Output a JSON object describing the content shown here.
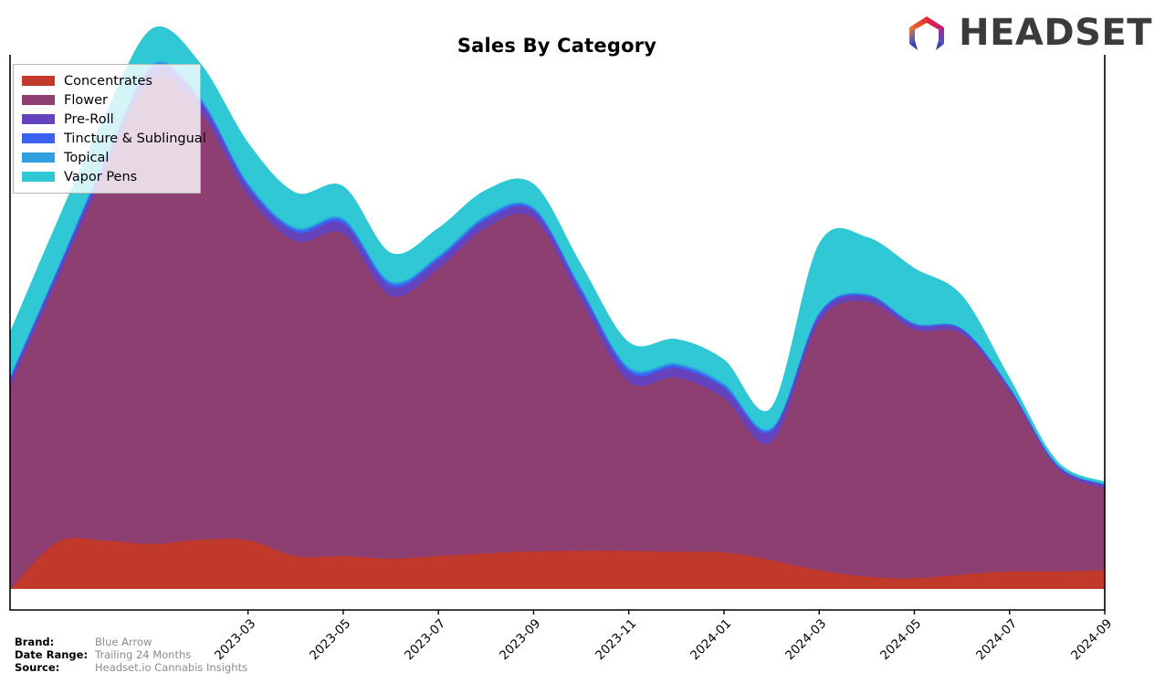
{
  "header": {
    "title": "Sales By Category",
    "logo_text": "HEADSET",
    "logo_icon": "headset-hexagon-logo"
  },
  "legend": {
    "position": "upper-left",
    "items": [
      {
        "label": "Concentrates",
        "color": "#c0392b"
      },
      {
        "label": "Flower",
        "color": "#8e3f72"
      },
      {
        "label": "Pre-Roll",
        "color": "#6543bd"
      },
      {
        "label": "Tincture & Sublingual",
        "color": "#3b63f0"
      },
      {
        "label": "Topical",
        "color": "#2f9fe0"
      },
      {
        "label": "Vapor Pens",
        "color": "#2fc8d4"
      }
    ]
  },
  "footer": {
    "rows": [
      {
        "key": "Brand:",
        "value": "Blue Arrow"
      },
      {
        "key": "Date Range:",
        "value": "Trailing 24 Months"
      },
      {
        "key": "Source:",
        "value": "Headset.io Cannabis Insights"
      }
    ]
  },
  "axis": {
    "x_ticks": [
      "2023-03",
      "2023-05",
      "2023-07",
      "2023-09",
      "2023-11",
      "2024-01",
      "2024-03",
      "2024-05",
      "2024-07",
      "2024-09"
    ],
    "x_tick_rotation": -45,
    "y_ticks": [],
    "grid": false
  },
  "chart_data": {
    "type": "area",
    "stacked": true,
    "title": "Sales By Category",
    "xlabel": "",
    "ylabel": "",
    "x": [
      "2022-10",
      "2022-11",
      "2022-12",
      "2023-01",
      "2023-02",
      "2023-03",
      "2023-04",
      "2023-05",
      "2023-06",
      "2023-07",
      "2023-08",
      "2023-09",
      "2023-10",
      "2023-11",
      "2023-12",
      "2024-01",
      "2024-02",
      "2024-03",
      "2024-04",
      "2024-05",
      "2024-06",
      "2024-07",
      "2024-08",
      "2024-09"
    ],
    "x_tick_labels": [
      "2023-03",
      "2023-05",
      "2023-07",
      "2023-09",
      "2023-11",
      "2024-01",
      "2024-03",
      "2024-05",
      "2024-07",
      "2024-09"
    ],
    "ylim": [
      0,
      1.0
    ],
    "series": [
      {
        "name": "Concentrates",
        "color": "#c0392b",
        "values": [
          0.0,
          0.09,
          0.092,
          0.086,
          0.094,
          0.093,
          0.063,
          0.063,
          0.058,
          0.063,
          0.068,
          0.072,
          0.073,
          0.073,
          0.071,
          0.07,
          0.055,
          0.036,
          0.024,
          0.021,
          0.028,
          0.034,
          0.034,
          0.036
        ]
      },
      {
        "name": "Flower",
        "color": "#8e3f72",
        "values": [
          0.385,
          0.498,
          0.7,
          0.88,
          0.81,
          0.652,
          0.596,
          0.61,
          0.497,
          0.544,
          0.616,
          0.63,
          0.474,
          0.32,
          0.33,
          0.292,
          0.224,
          0.47,
          0.52,
          0.47,
          0.455,
          0.34,
          0.195,
          0.155
        ]
      },
      {
        "name": "Pre-Roll",
        "color": "#6543bd",
        "values": [
          0.012,
          0.014,
          0.016,
          0.019,
          0.018,
          0.016,
          0.017,
          0.019,
          0.018,
          0.016,
          0.015,
          0.014,
          0.016,
          0.018,
          0.018,
          0.019,
          0.02,
          0.013,
          0.01,
          0.009,
          0.008,
          0.007,
          0.006,
          0.006
        ]
      },
      {
        "name": "Tincture & Sublingual",
        "color": "#3b63f0",
        "values": [
          0.004,
          0.004,
          0.005,
          0.005,
          0.005,
          0.005,
          0.005,
          0.006,
          0.006,
          0.005,
          0.005,
          0.004,
          0.005,
          0.006,
          0.005,
          0.005,
          0.004,
          0.003,
          0.003,
          0.002,
          0.002,
          0.002,
          0.001,
          0.001
        ]
      },
      {
        "name": "Topical",
        "color": "#2f9fe0",
        "values": [
          0.003,
          0.003,
          0.004,
          0.004,
          0.004,
          0.004,
          0.004,
          0.004,
          0.004,
          0.004,
          0.004,
          0.003,
          0.004,
          0.004,
          0.004,
          0.004,
          0.003,
          0.002,
          0.002,
          0.002,
          0.001,
          0.001,
          0.001,
          0.001
        ]
      },
      {
        "name": "Vapor Pens",
        "color": "#2fc8d4",
        "values": [
          0.08,
          0.086,
          0.079,
          0.066,
          0.062,
          0.073,
          0.064,
          0.059,
          0.052,
          0.05,
          0.046,
          0.042,
          0.04,
          0.045,
          0.044,
          0.043,
          0.037,
          0.128,
          0.106,
          0.102,
          0.06,
          0.014,
          0.004,
          0.003
        ]
      }
    ]
  }
}
